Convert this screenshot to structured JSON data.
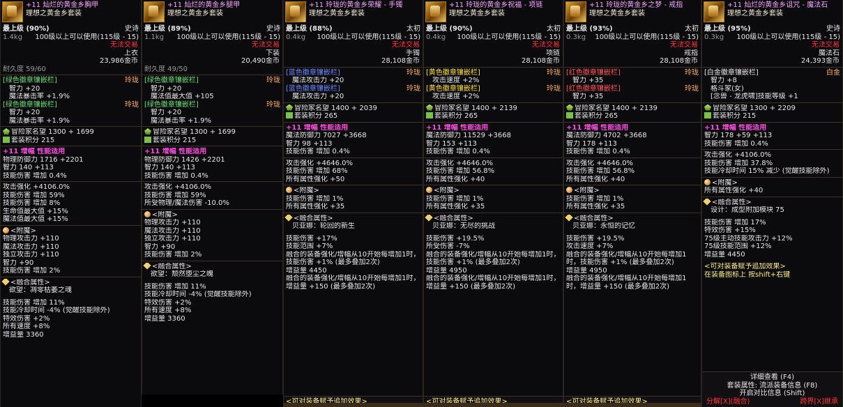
{
  "panels": [
    {
      "name": "+11 灿烂的黄金乡胸甲",
      "set": "理想之黄金乡套装",
      "grade": "最上级",
      "grade_pct": "(90%)",
      "rarity": "史诗",
      "weight": "1.4kg",
      "level_req": "100级以上可以使用(115级 - 15)",
      "trade": "无法交易",
      "type": "上衣",
      "price": "23,986金币",
      "durability": "耐久度 59/60",
      "sockets": [
        {
          "label": "[绿色徽章镶嵌栏]",
          "tag": "玲珑",
          "lines": [
            "智力 +20",
            "魔法暴击率 +1.9%"
          ]
        },
        {
          "label": "[绿色徽章镶嵌栏]",
          "tag": "玲珑",
          "lines": [
            "智力 +20",
            "魔法暴击率 +1.9%"
          ]
        }
      ],
      "reputation": "冒险家名望 1300 + 1699",
      "set_points": "套装积分 215",
      "amp_title": "+11 增幅 性能适用",
      "stats": [
        "物理防御力 1716 +2201",
        "智力 140 +113",
        "技能伤害 增加 0.4%"
      ],
      "stats2": [
        "攻击强化 +4106.0%",
        "技能伤害 增加 59%",
        "技能伤害 增加 8%",
        "生命值最大值 +15%",
        "魔法值最大值 +15%"
      ],
      "enchant_title": "<附魔>",
      "enchant": [
        "物理攻击力 +110",
        "魔法攻击力 +110",
        "独立攻击力 +110",
        "智力 +90",
        "技能伤害 增加 2%"
      ],
      "fusion_title": "<融合属性>",
      "fusion_name": "欲望：凋零枯萎之魂",
      "fusion": [
        "技能伤害 增加 11%",
        "技能冷却时间 -4% (觉醒技能除外)",
        "特效伤害 +2%",
        "所有速度 +8%",
        "增益量 3360"
      ]
    },
    {
      "name": "+11 灿烂的黄金乡腿甲",
      "set": "理想之黄金乡套装",
      "grade": "最上级",
      "grade_pct": "(89%)",
      "rarity": "史诗",
      "weight": "1.1kg",
      "level_req": "100级以上可以使用(115级 - 15)",
      "trade": "无法交易",
      "type": "下装",
      "price": "20,490金币",
      "durability": "耐久度 49/50",
      "sockets": [
        {
          "label": "[绿色徽章镶嵌栏]",
          "tag": "玲珑",
          "lines": [
            "智力 +20",
            "魔法值最大值 +105"
          ]
        },
        {
          "label": "[绿色徽章镶嵌栏]",
          "tag": "玲珑",
          "lines": [
            "智力 +20",
            "魔法暴击率 +1.9%"
          ]
        }
      ],
      "reputation": "冒险家名望 1300 + 1699",
      "set_points": "套装积分 215",
      "amp_title": "+11 增幅 性能适用",
      "stats": [
        "物理防御力 1426 +2201",
        "智力 140 +113",
        "技能伤害 增加 0.4%"
      ],
      "stats2": [
        "攻击强化 +4106.0%",
        "技能伤害 增加 59%",
        "所受物理/魔法伤害 -10.0%"
      ],
      "enchant_title": "<附魔>",
      "enchant": [
        "物理攻击力 +110",
        "魔法攻击力 +110",
        "独立攻击力 +110",
        "智力 +90",
        "技能伤害 增加 2%"
      ],
      "fusion_title": "<融合属性>",
      "fusion_name": "欲望：颓然堕尘之魄",
      "fusion": [
        "技能伤害 增加 11%",
        "技能冷却时间 -4% (觉醒技能除外)",
        "特效伤害 +2%",
        "所有速度 +8%",
        "增益量 3360"
      ]
    },
    {
      "name": "+11 玲珑的黄金乡荣耀 - 手镯",
      "set": "理想之黄金乡套装",
      "grade": "最上级",
      "grade_pct": "(88%)",
      "rarity": "太初",
      "weight": "0.4kg",
      "level_req": "100级以上可以使用(115级 - 15)",
      "trade": "无法交易",
      "type": "手镯",
      "price": "28,108金币",
      "sockets": [
        {
          "label": "[蓝色徽章镶嵌栏]",
          "tag": "玲珑",
          "lines": [
            "魔法攻击力 +20"
          ]
        },
        {
          "label": "[蓝色徽章镶嵌栏]",
          "tag": "玲珑",
          "lines": [
            "魔法攻击力 +20"
          ]
        }
      ],
      "reputation": "冒险家名望 1400 + 2039",
      "set_points": "套装积分 265",
      "amp_title": "+11 增幅 性能适用",
      "stats": [
        "魔法防御力 7027 +3668",
        "智力 98 +113",
        "技能伤害 增加 0.4%"
      ],
      "stats2": [
        "攻击强化 +4646.0%",
        "技能伤害 增加 68%",
        "所有属性强化 +50"
      ],
      "enchant_title": "<附魔>",
      "enchant": [
        "技能伤害 增加 1%",
        "所有属性强化 +35"
      ],
      "fusion_title": "<融合属性>",
      "fusion_name": "贝亚娜：轮回的新生",
      "fusion": [
        "技能伤害 +17%",
        "技能范围 +7%",
        "融合的装备强化/增幅从10开始每增加1时，技能伤害 +1% (最多叠加2次)",
        "增益量 4450",
        "融合的装备强化/增幅从10开始每增加1时，增益量 +150 (最多叠加2次)"
      ],
      "footer": "<可对装备赋予追加效果>"
    },
    {
      "name": "+11 玲珑的黄金乡祝福 - 项链",
      "set": "理想之黄金乡套装",
      "grade": "最上级",
      "grade_pct": "(90%)",
      "rarity": "太初",
      "weight": "0.4kg",
      "level_req": "100级以上可以使用(115级 - 15)",
      "trade": "无法交易",
      "type": "项链",
      "price": "28,108金币",
      "sockets": [
        {
          "label": "[黄色徽章镶嵌栏]",
          "tag": "玲珑",
          "lines": [
            "攻击速度 +2%"
          ]
        },
        {
          "label": "[黄色徽章镶嵌栏]",
          "tag": "玲珑",
          "lines": [
            "攻击速度 +2%"
          ]
        }
      ],
      "reputation": "冒险家名望 1400 + 2139",
      "set_points": "套装积分 265",
      "amp_title": "+11 增幅 性能适用",
      "stats": [
        "魔法防御力 11529 +3668",
        "智力 153 +113",
        "技能伤害 增加 0.4%"
      ],
      "stats2": [
        "攻击强化 +4646.0%",
        "技能伤害 增加 56.8%",
        "所有属性强化 +40"
      ],
      "enchant_title": "<附魔>",
      "enchant": [
        "技能伤害 增加 1%",
        "所有属性强化 +35"
      ],
      "fusion_title": "<融合属性>",
      "fusion_name": "贝亚娜：无尽的挑战",
      "fusion": [
        "技能伤害 +19.5%",
        "所受伤害 -7%",
        "融合的装备强化/增幅从10开始每增加1时，技能伤害 +1% (最多叠加2次)",
        "增益量 4950",
        "融合的装备强化/增幅从10开始每增加1时，增益量 +150 (最多叠加2次)"
      ],
      "footer": "<可对装备赋予追加效果>"
    },
    {
      "name": "+11 玲珑的黄金乡之梦 - 戒指",
      "set": "理想之黄金乡套装",
      "grade": "最上级",
      "grade_pct": "(93%)",
      "rarity": "太初",
      "weight": "0.3kg",
      "level_req": "100级以上可以使用(115级 - 15)",
      "trade": "无法交易",
      "type": "戒指",
      "price": "28,108金币",
      "sockets": [
        {
          "label": "[红色徽章镶嵌栏]",
          "tag": "玲珑",
          "lines": [
            "智力 +35"
          ]
        },
        {
          "label": "[红色徽章镶嵌栏]",
          "tag": "玲珑",
          "lines": [
            "智力 +35"
          ]
        }
      ],
      "reputation": "冒险家名望 1400 + 2139",
      "set_points": "套装积分 265",
      "amp_title": "+11 增幅 性能适用",
      "stats": [
        "魔法防御力 4702 +3668",
        "智力 178 +113",
        "技能伤害 增加 0.4%"
      ],
      "stats2": [
        "攻击强化 +4646.0%",
        "技能伤害 增加 56.8%",
        "所有属性强化 +40"
      ],
      "enchant_title": "<附魔>",
      "enchant": [
        "技能伤害 增加 1%",
        "所有属性强化 +35"
      ],
      "fusion_title": "<融合属性>",
      "fusion_name": "贝亚娜：永恒的记忆",
      "fusion": [
        "技能伤害 +19.5%",
        "攻击速度 +7%",
        "融合的装备强化/增幅从10开始每增加1时，技能伤害 +1% (最多叠加2次)",
        "增益量 4950",
        "融合的装备强化/增幅从10开始每增加1时，增益量 +150 (最多叠加2次)"
      ],
      "footer": "<可对装备赋予追加效果>"
    },
    {
      "name": "+11 灿烂的黄金乡诅咒 - 魔法石",
      "set": "理想之黄金乡套装",
      "grade": "最上级",
      "grade_pct": "(95%)",
      "rarity": "史诗",
      "weight": "0.3kg",
      "level_req": "100级以上可以使用(115级 - 15)",
      "trade": "无法交易",
      "type": "魔法石",
      "price": "24,393金币",
      "sockets": [
        {
          "label": "[白金徽章镶嵌栏]",
          "tag": "白金",
          "lines": [
            "智力 +8",
            "格斗家(女)",
            "[念兽 - 龙虎啸]技能等级 +1"
          ]
        }
      ],
      "reputation": "冒险家名望 1300 + 2209",
      "set_points": "套装积分 215",
      "amp_title": "+11 增幅 性能适用",
      "stats": [
        "智力 178 +59 +113",
        "技能伤害 增加 0.4%"
      ],
      "stats2": [
        "攻击强化 +4106.0%",
        "技能伤害 增加 37.8%",
        "技能冷却时间 15% 减少 (觉醒技能除外)"
      ],
      "enchant_title": "<附魔>",
      "enchant": [
        "所有属性强化 +40"
      ],
      "fusion_title": "<融合属性>",
      "fusion_name": "设计：成型附加模块 75",
      "fusion": [
        "技能伤害 增加 17%",
        "特效伤害 +15%",
        "75级主动技能攻击力 +12%",
        "75级技能范围 +12%",
        "增益量 4450"
      ],
      "extra": [
        "<可对装备赋予追加效果>",
        "在装备图标上 按shift+右键"
      ],
      "footer_lines": [
        "详细查看 (F4)",
        "套装属性: 流派装备信息 (F8)",
        "开启对比信息 (Shift)"
      ],
      "footer_actions": [
        "分解[X](融合)",
        "跨界[X]继承"
      ]
    }
  ]
}
